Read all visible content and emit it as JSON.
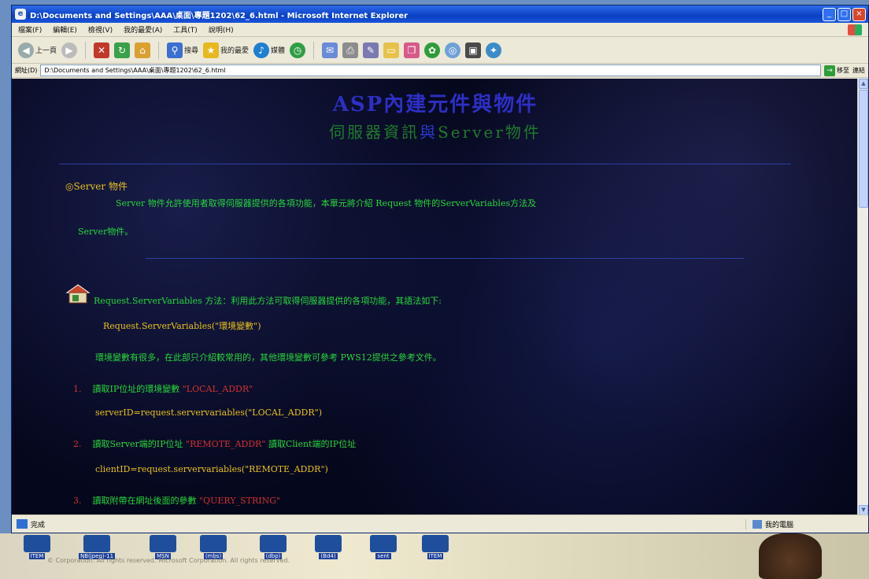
{
  "window": {
    "title": "D:\\Documents and Settings\\AAA\\桌面\\專題1202\\62_6.html - Microsoft Internet Explorer",
    "controls": [
      "_",
      "□",
      "×"
    ]
  },
  "menu": {
    "items": [
      "檔案(F)",
      "編輯(E)",
      "檢視(V)",
      "我的最愛(A)",
      "工具(T)",
      "說明(H)"
    ]
  },
  "toolbar": {
    "back_label": "上一頁",
    "search_label": "搜尋",
    "favorites_label": "我的最愛",
    "media_label": "媒體"
  },
  "address": {
    "label": "網址(D)",
    "value": "D:\\Documents and Settings\\AAA\\桌面\\專題1202\\62_6.html",
    "go_label": "移至",
    "links_label": "連結"
  },
  "page": {
    "title": "ASP內建元件與物件",
    "subtitle_a": "伺服器資訊",
    "subtitle_amp": "與",
    "subtitle_b": "Server物件",
    "section_heading": "◎Server 物件",
    "intro_line1": "Server 物件允許使用者取得伺服器提供的各項功能，本單元將介紹 Request 物件的ServerVariables方法及",
    "intro_line2": "Server物件。",
    "method_line": "Request.ServerVariables 方法：利用此方法可取得伺服器提供的各項功能，其語法如下:",
    "syntax_line": "Request.ServerVariables(\"環境變數\")",
    "note_line": "環境變數有很多，在此部只介紹較常用的，其他環境變數可參考 PWS12提供之參考文件。",
    "items": [
      {
        "num": "1.",
        "text": "讀取IP位址的環境變數",
        "key": "\"LOCAL_ADDR\"",
        "text2": "",
        "code": "serverID=request.servervariables(\"LOCAL_ADDR\")"
      },
      {
        "num": "2.",
        "text": "讀取Server端的IP位址",
        "key": "\"REMOTE_ADDR\"",
        "text2": "讀取Client端的IP位址",
        "code": "clientID=request.servervariables(\"REMOTE_ADDR\")"
      },
      {
        "num": "3.",
        "text": "讀取附帶在網址後面的參數",
        "key": "\"QUERY_STRING\"",
        "text2": "",
        "code": ""
      }
    ]
  },
  "status": {
    "text": "完成",
    "zone": "我的電腦"
  },
  "desktop": {
    "icons": [
      "ITEM",
      "NB(jpeg)-11",
      "MSN",
      "(mbs)",
      "(dbp)",
      "(Bd4)",
      "sent",
      "ITEM"
    ],
    "copyright": "© Corporation. All rights reserved. Microsoft Corporation. All rights reserved."
  }
}
